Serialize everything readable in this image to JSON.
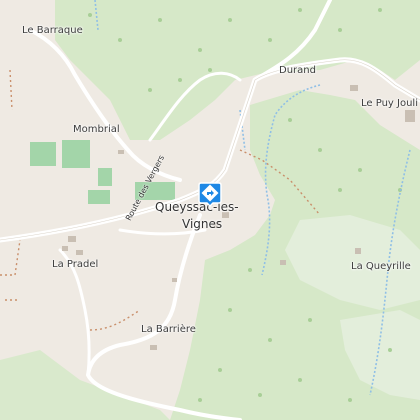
{
  "places": {
    "le_barraque": "Le Barraque",
    "durand": "Durand",
    "le_puy_joulie": "Le Puy Jouli",
    "mombrial": "Mombrial",
    "village": "Queyssac-les-Vignes",
    "village_line1": "Queyssac-les-",
    "village_line2": "Vignes",
    "la_pradel": "La Pradel",
    "la_queyrille": "La Queyrille",
    "la_barriere": "La Barrière"
  },
  "roads": {
    "route_des_vergers": "Route des Vergers"
  },
  "marker": {
    "icon": "directions-icon",
    "color": "#1e88e5"
  },
  "colors": {
    "forest": "#d6e8c8",
    "open_land": "#efeae3",
    "road": "#ffffff",
    "stream": "#8fbfe6",
    "path": "#c98f6b",
    "vineyard": "#9bd3a3"
  }
}
